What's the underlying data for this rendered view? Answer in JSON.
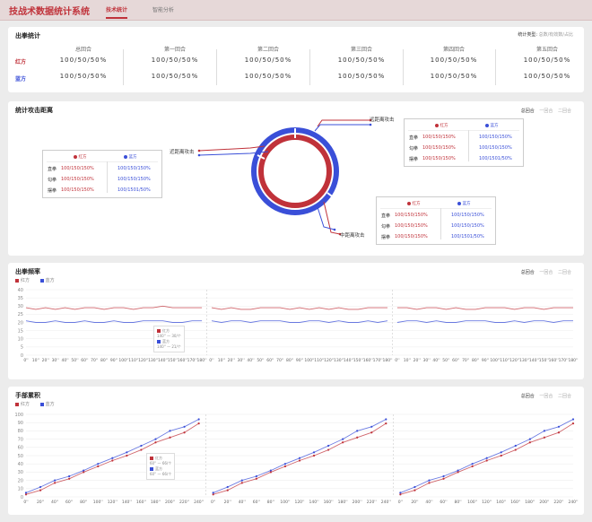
{
  "app": {
    "title": "技战术数据统计系统",
    "tabs": [
      {
        "label": "技术统计",
        "active": true
      },
      {
        "label": "智能分析",
        "active": false
      }
    ]
  },
  "colors": {
    "red": "#c0323a",
    "blue": "#3a4fd8"
  },
  "punch_stats": {
    "title": "出拳统计",
    "note_label": "统计类型:",
    "note_value": "总数/有效数/占比",
    "rounds": [
      "总回合",
      "第一回合",
      "第二回合",
      "第三回合",
      "第四回合",
      "第五回合"
    ],
    "rows": [
      {
        "label": "红方",
        "values": [
          "100/50/50%",
          "100/50/50%",
          "100/50/50%",
          "100/50/50%",
          "100/50/50%",
          "100/50/50%"
        ]
      },
      {
        "label": "蓝方",
        "values": [
          "100/50/50%",
          "100/50/50%",
          "100/50/50%",
          "100/50/50%",
          "100/50/50%",
          "100/50/50%"
        ]
      }
    ]
  },
  "distance": {
    "title": "统计攻击距离",
    "tabs": [
      "总回合",
      "一回合",
      "二回合"
    ],
    "labels": {
      "long": "远距离攻击",
      "mid": "中距离攻击",
      "short": "近距离攻击"
    },
    "table_head": [
      "红方",
      "蓝方"
    ],
    "table_rows": [
      "直拳",
      "勾拳",
      "摆拳"
    ],
    "long_values": [
      [
        "100/150/150%",
        "100/150/150%"
      ],
      [
        "100/150/150%",
        "100/150/150%"
      ],
      [
        "100/150/150%",
        "100/1501/50%"
      ]
    ],
    "short_values": [
      [
        "100/150/150%",
        "100/150/150%"
      ],
      [
        "100/150/150%",
        "100/150/150%"
      ],
      [
        "100/150/150%",
        "100/1501/50%"
      ]
    ],
    "mid_values": [
      [
        "100/150/150%",
        "100/150/150%"
      ],
      [
        "100/150/150%",
        "100/150/150%"
      ],
      [
        "100/150/150%",
        "100/1501/50%"
      ]
    ]
  },
  "frequency": {
    "title": "出拳频率",
    "tabs": [
      "总回合",
      "一回合",
      "二回合"
    ],
    "legend": [
      "红方",
      "蓝方"
    ],
    "tooltip": {
      "red_label": "红方",
      "red_value": "140'' — 30/个",
      "blue_label": "蓝方",
      "blue_value": "140'' — 21/个"
    }
  },
  "accumulation": {
    "title": "手部累积",
    "tabs": [
      "总回合",
      "一回合",
      "二回合"
    ],
    "legend": [
      "红方",
      "蓝方"
    ],
    "tooltip": {
      "red_label": "红方",
      "red_value": "60'' — 66/个",
      "blue_label": "蓝方",
      "blue_value": "60'' — 66/个"
    }
  },
  "chart_data": [
    {
      "type": "line",
      "title": "出拳频率",
      "x": [
        "0''",
        "10''",
        "20''",
        "30''",
        "40''",
        "50''",
        "60''",
        "70''",
        "80''",
        "90''",
        "100''",
        "110''",
        "120''",
        "130''",
        "140''",
        "150''",
        "160''",
        "170''",
        "180''"
      ],
      "x_repeats": 3,
      "ylim": [
        0,
        40
      ],
      "yticks": [
        0,
        5,
        10,
        15,
        20,
        25,
        30,
        35,
        40
      ],
      "series": [
        {
          "name": "红方",
          "values": [
            29,
            28,
            29,
            28,
            29,
            28,
            29,
            29,
            28,
            29,
            29,
            28,
            29,
            29,
            30,
            29,
            29,
            29,
            29,
            29,
            28,
            29,
            28,
            28,
            29,
            29,
            29,
            28,
            29,
            28,
            29,
            28,
            29,
            28,
            28,
            29,
            29,
            29,
            29,
            29,
            28,
            29,
            29,
            28,
            29,
            28,
            28,
            29,
            29,
            29,
            28,
            29,
            29,
            28,
            29,
            29,
            29
          ]
        },
        {
          "name": "蓝方",
          "values": [
            21,
            20,
            20,
            21,
            20,
            20,
            21,
            20,
            20,
            21,
            20,
            20,
            21,
            21,
            21,
            20,
            20,
            21,
            21,
            21,
            20,
            21,
            21,
            20,
            21,
            21,
            21,
            20,
            20,
            21,
            21,
            20,
            21,
            20,
            20,
            21,
            20,
            21,
            20,
            21,
            21,
            20,
            21,
            20,
            20,
            21,
            21,
            21,
            20,
            20,
            21,
            20,
            21,
            21,
            20,
            21,
            21
          ]
        }
      ]
    },
    {
      "type": "line",
      "title": "手部累积",
      "x": [
        "0''",
        "20''",
        "40''",
        "60''",
        "80''",
        "100''",
        "120''",
        "140''",
        "160''",
        "180''",
        "200''",
        "220''",
        "240''"
      ],
      "x_repeats": 3,
      "ylim": [
        0,
        100
      ],
      "yticks": [
        0,
        10,
        20,
        30,
        40,
        50,
        60,
        70,
        80,
        90,
        100
      ],
      "series": [
        {
          "name": "红方",
          "values": [
            3,
            8,
            17,
            22,
            30,
            37,
            44,
            50,
            57,
            66,
            72,
            78,
            89,
            3,
            8,
            17,
            22,
            30,
            37,
            44,
            50,
            57,
            66,
            72,
            78,
            89,
            3,
            8,
            17,
            22,
            30,
            37,
            44,
            50,
            57,
            66,
            72,
            78,
            89
          ]
        },
        {
          "name": "蓝方",
          "values": [
            5,
            12,
            20,
            25,
            32,
            40,
            47,
            54,
            62,
            70,
            80,
            85,
            94,
            5,
            12,
            20,
            25,
            32,
            40,
            47,
            54,
            62,
            70,
            80,
            85,
            94,
            5,
            12,
            20,
            25,
            32,
            40,
            47,
            54,
            62,
            70,
            80,
            85,
            94
          ]
        }
      ]
    }
  ]
}
